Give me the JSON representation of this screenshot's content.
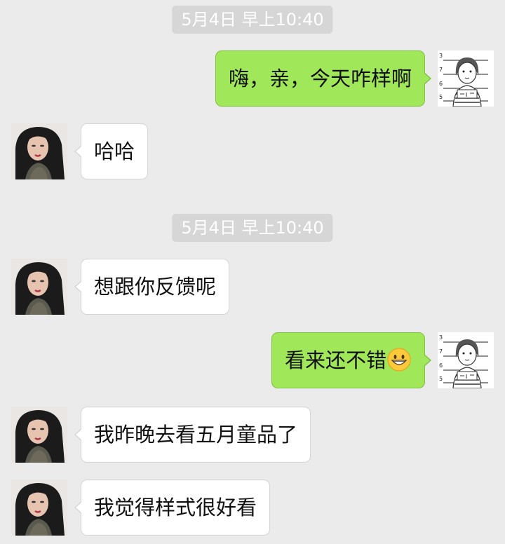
{
  "chat": {
    "timestamps": [
      "5月4日 早上10:40",
      "5月4日 早上10:40"
    ],
    "messages": [
      {
        "sender": "me",
        "text": "嗨，亲，今天咋样啊"
      },
      {
        "sender": "contact",
        "text": "哈哈"
      },
      {
        "sender": "contact",
        "text": "想跟你反馈呢"
      },
      {
        "sender": "me",
        "text": "看来还不错",
        "emoji": "grinning-face"
      },
      {
        "sender": "contact",
        "text": "我昨晚去看五月童品了"
      },
      {
        "sender": "contact",
        "text": "我觉得样式很好看"
      }
    ]
  },
  "colors": {
    "background": "#ebebeb",
    "outgoing_bubble": "#a0e75a",
    "incoming_bubble": "#ffffff",
    "timestamp_pill": "#d6d6d6"
  },
  "icons": {
    "my_avatar": "sketch-girl-avatar",
    "contact_avatar": "long-hair-woman-avatar",
    "emoji": "grinning-face-emoji"
  }
}
